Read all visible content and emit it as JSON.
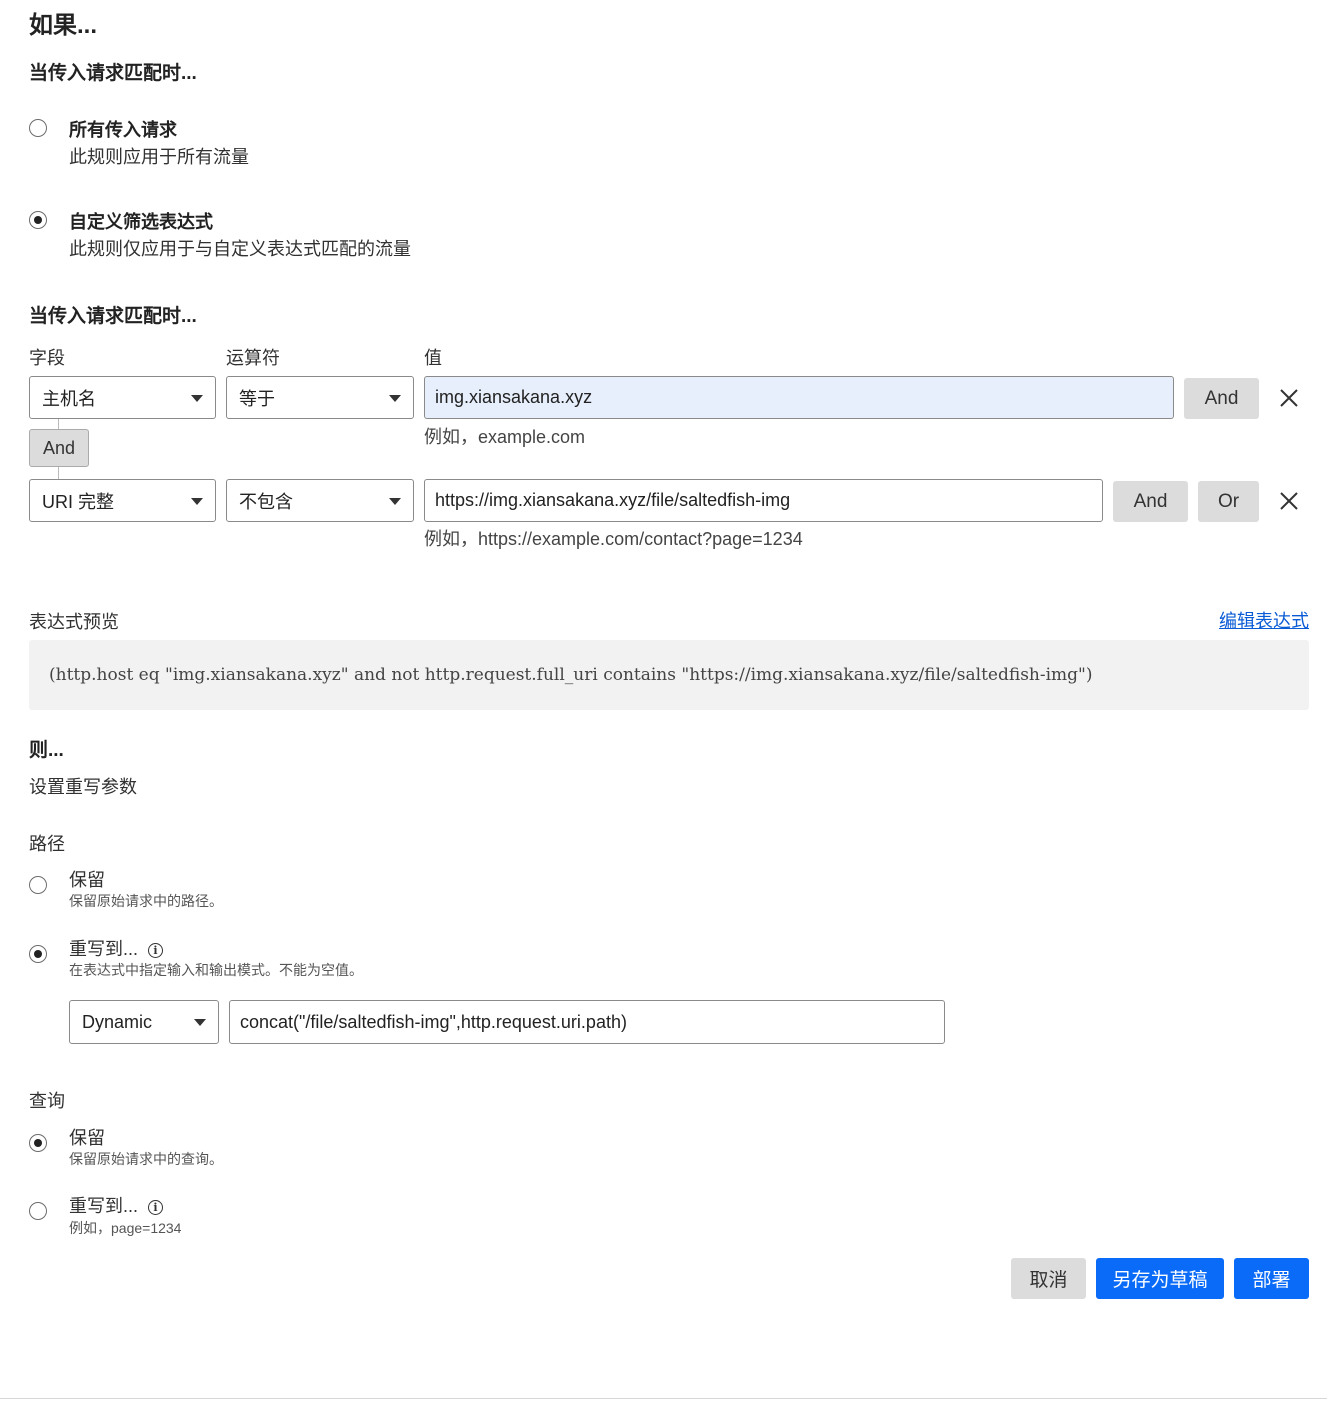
{
  "headings": {
    "if": "如果...",
    "when1": "当传入请求匹配时...",
    "when2": "当传入请求匹配时...",
    "then": "则...",
    "rewrite_params": "设置重写参数"
  },
  "match_options": [
    {
      "title": "所有传入请求",
      "desc": "此规则应用于所有流量",
      "selected": false
    },
    {
      "title": "自定义筛选表达式",
      "desc": "此规则仅应用于与自定义表达式匹配的流量",
      "selected": true
    }
  ],
  "columns": {
    "field": "字段",
    "operator": "运算符",
    "value": "值"
  },
  "conditions": [
    {
      "field": "主机名",
      "operator": "等于",
      "value": "img.xiansakana.xyz",
      "hint": "例如，example.com",
      "and_label": "And"
    },
    {
      "field": "URI 完整",
      "operator": "不包含",
      "value": "https://img.xiansakana.xyz/file/saltedfish-img",
      "hint": "例如，https://example.com/contact?page=1234",
      "and_label": "And",
      "or_label": "Or"
    }
  ],
  "connector": "And",
  "expression": {
    "label": "表达式预览",
    "edit_link": "编辑表达式",
    "text": "(http.host eq \"img.xiansakana.xyz\" and not http.request.full_uri contains \"https://img.xiansakana.xyz/file/saltedfish-img\")"
  },
  "path": {
    "label": "路径",
    "preserve": {
      "title": "保留",
      "desc": "保留原始请求中的路径。",
      "selected": false
    },
    "rewrite": {
      "title": "重写到...",
      "desc": "在表达式中指定输入和输出模式。不能为空值。",
      "selected": true
    },
    "mode": "Dynamic",
    "value": "concat(\"/file/saltedfish-img\",http.request.uri.path)"
  },
  "query": {
    "label": "查询",
    "preserve": {
      "title": "保留",
      "desc": "保留原始请求中的查询。",
      "selected": true
    },
    "rewrite": {
      "title": "重写到...",
      "desc": "例如，page=1234",
      "selected": false
    }
  },
  "actions": {
    "cancel": "取消",
    "save_draft": "另存为草稿",
    "deploy": "部署"
  },
  "colors": {
    "primary": "#0a6bf8",
    "link": "#0a5bd6",
    "focus_bg": "#e8effc"
  }
}
